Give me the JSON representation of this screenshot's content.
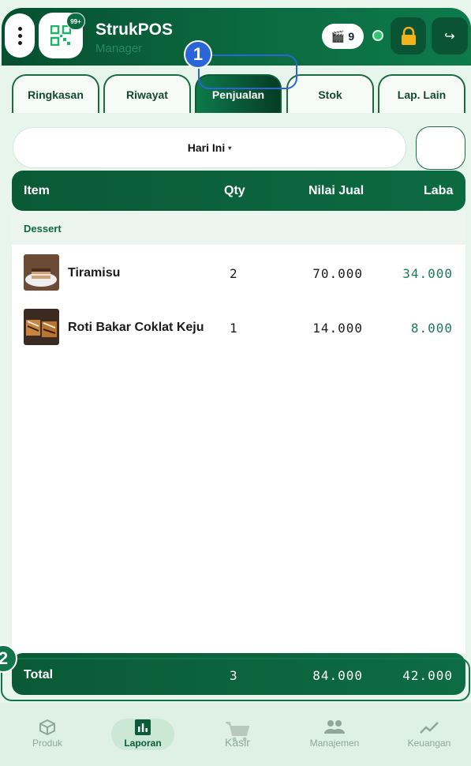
{
  "header": {
    "title": "StrukPOS",
    "subtitle": "Manager",
    "qr_badge": "99+",
    "counter_value": "9",
    "status_color": "#2fc46f"
  },
  "tabs": [
    {
      "label": "Ringkasan",
      "active": false
    },
    {
      "label": "Riwayat",
      "active": false
    },
    {
      "label": "Penjualan",
      "active": true
    },
    {
      "label": "Stok",
      "active": false
    },
    {
      "label": "Lap. Lain",
      "active": false
    }
  ],
  "annotations": {
    "marker_1": "1",
    "marker_2": "2"
  },
  "filter": {
    "period": "Hari Ini",
    "caret": "▾"
  },
  "table": {
    "columns": {
      "item": "Item",
      "qty": "Qty",
      "sale_value": "Nilai Jual",
      "profit": "Laba"
    },
    "category": "Dessert",
    "rows": [
      {
        "name": "Tiramisu",
        "qty": "2",
        "sale_value": "70.000",
        "profit": "34.000"
      },
      {
        "name": "Roti Bakar Coklat Keju",
        "qty": "1",
        "sale_value": "14.000",
        "profit": "8.000"
      }
    ]
  },
  "total": {
    "label": "Total",
    "qty": "3",
    "sale_value": "84.000",
    "profit": "42.000"
  },
  "bottom_nav": [
    {
      "label": "Produk",
      "icon": "box-icon",
      "active": false
    },
    {
      "label": "Laporan",
      "icon": "bar-chart-icon",
      "active": true
    },
    {
      "label": "Kasir",
      "icon": "cart-icon",
      "active": false
    },
    {
      "label": "Manajemen",
      "icon": "people-icon",
      "active": false
    },
    {
      "label": "Keuangan",
      "icon": "trend-icon",
      "active": false
    }
  ],
  "colors": {
    "brand_dark": "#0a5a36",
    "brand": "#0d7a4a",
    "profit_text": "#1d7a56",
    "annotation_blue": "#2b66d9"
  }
}
